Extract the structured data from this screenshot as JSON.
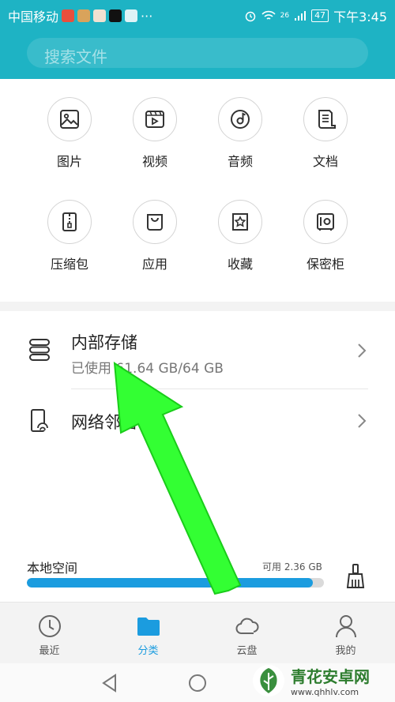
{
  "status_bar": {
    "carrier": "中国移动",
    "more": "···",
    "network": "26",
    "battery": "47",
    "time": "下午3:45",
    "icons": [
      "alarm-icon",
      "wifi-icon",
      "signal-icon",
      "battery-icon"
    ]
  },
  "search": {
    "placeholder": "搜索文件"
  },
  "categories": [
    {
      "label": "图片",
      "icon": "image-icon"
    },
    {
      "label": "视频",
      "icon": "video-icon"
    },
    {
      "label": "音频",
      "icon": "audio-icon"
    },
    {
      "label": "文档",
      "icon": "document-icon"
    },
    {
      "label": "压缩包",
      "icon": "archive-icon"
    },
    {
      "label": "应用",
      "icon": "app-bag-icon"
    },
    {
      "label": "收藏",
      "icon": "star-icon"
    },
    {
      "label": "保密柜",
      "icon": "safe-icon"
    }
  ],
  "storage": {
    "internal": {
      "title": "内部存储",
      "usage": "已使用 61.64 GB/64 GB"
    },
    "network": {
      "title": "网络邻居"
    }
  },
  "local_space": {
    "title": "本地空间",
    "available": "可用 2.36 GB",
    "used_fraction": 0.963
  },
  "bottom_nav": [
    {
      "label": "最近",
      "icon": "clock-icon",
      "active": false
    },
    {
      "label": "分类",
      "icon": "folder-icon",
      "active": true
    },
    {
      "label": "云盘",
      "icon": "cloud-icon",
      "active": false
    },
    {
      "label": "我的",
      "icon": "person-icon",
      "active": false
    }
  ],
  "colors": {
    "header": "#1eb3c4",
    "accent": "#1b9cdf",
    "annotation_arrow": "#33ff33"
  },
  "watermark": {
    "title": "青花安卓网",
    "url": "www.qhhlv.com"
  }
}
